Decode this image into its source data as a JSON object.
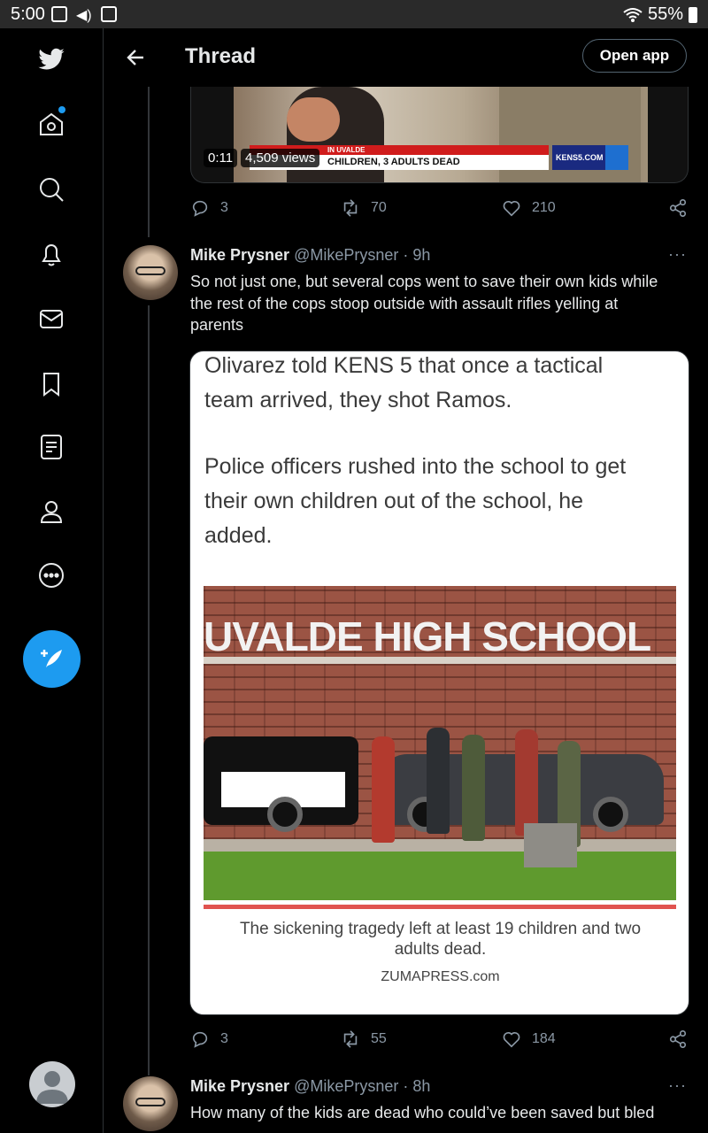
{
  "status_bar": {
    "time": "5:00",
    "battery": "55%"
  },
  "header": {
    "title": "Thread",
    "open_app": "Open app"
  },
  "video": {
    "time": "0:11",
    "views": "4,509 views",
    "ticker_top": "IN UVALDE",
    "ticker_bottom": "CHILDREN, 3 ADULTS DEAD",
    "logo": "KENS5.COM"
  },
  "tweet0_actions": {
    "replies": "3",
    "retweets": "70",
    "likes": "210"
  },
  "tweet1": {
    "name": "Mike Prysner",
    "handle": "@MikePrysner",
    "time": "· 9h",
    "text_line1": "So not just one, but several cops went to save their own kids while",
    "text_line2": "the rest of the cops stoop outside with assault rifles yelling at",
    "text_line3": "parents",
    "image": {
      "para1_line1": "Olivarez told KENS 5 that once a tactical",
      "para1_line2": "team arrived, they shot Ramos.",
      "para2_line1": "Police officers rushed into the school to get",
      "para2_line2": "their own children out of the school, he",
      "para2_line3": "added.",
      "sign": "UVALDE HIGH SCHOOL",
      "caption_line1": "The sickening tragedy left at least 19 children and two",
      "caption_line2": "adults dead.",
      "credit": "ZUMAPRESS.com"
    },
    "replies": "3",
    "retweets": "55",
    "likes": "184"
  },
  "tweet2": {
    "name": "Mike Prysner",
    "handle": "@MikePrysner",
    "time": "· 8h",
    "text_line1": "How many of the kids are dead who could’ve been saved but bled"
  },
  "more": "···",
  "colors": {
    "accent": "#1d9bf0",
    "background": "#000000"
  }
}
